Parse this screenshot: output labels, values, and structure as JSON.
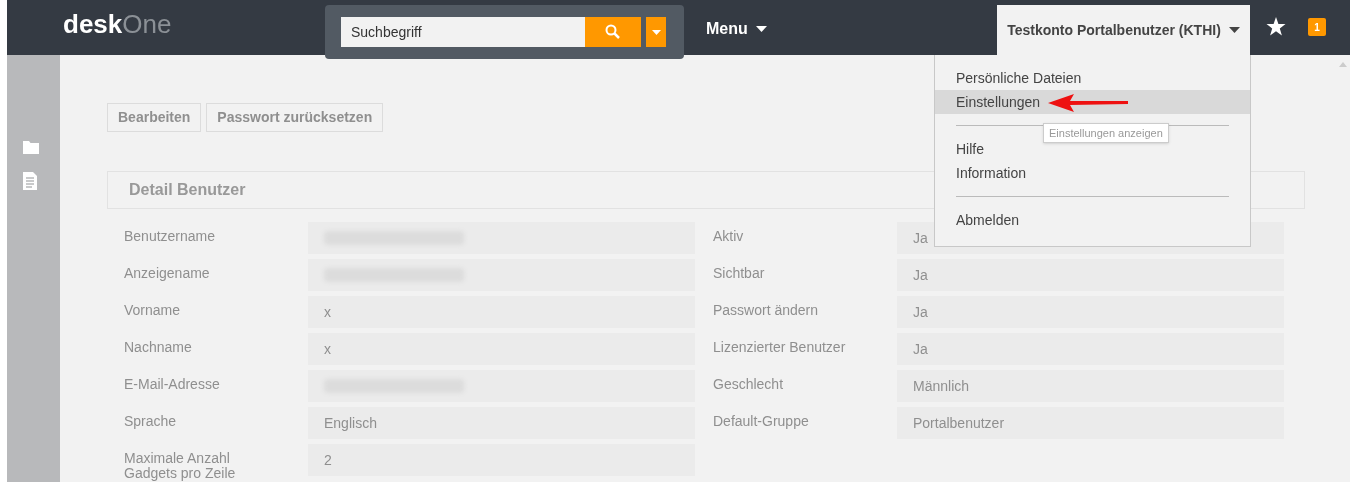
{
  "header": {
    "logo": {
      "bold": "desk",
      "light": "One"
    },
    "search": {
      "placeholder": "Suchbegriff"
    },
    "menu": "Menu",
    "user": "Testkonto Portalbenutzer (KTHI)",
    "notifications": "1"
  },
  "sidebar": {
    "items": [
      {
        "kind": "folder"
      },
      {
        "kind": "document"
      }
    ]
  },
  "actions": [
    "Bearbeiten",
    "Passwort zurücksetzen"
  ],
  "panel": {
    "title": "Detail Benutzer"
  },
  "fields_left": [
    {
      "label": "Benutzername",
      "kind": "blurred"
    },
    {
      "label": "Anzeigename",
      "kind": "blurred"
    },
    {
      "label": "Vorname",
      "kind": "text",
      "value": "x"
    },
    {
      "label": "Nachname",
      "kind": "text",
      "value": "x"
    },
    {
      "label": "E-Mail-Adresse",
      "kind": "blurred"
    },
    {
      "label": "Sprache",
      "kind": "text",
      "value": "Englisch"
    },
    {
      "label": "Maximale Anzahl Gadgets pro Zeile",
      "kind": "text",
      "value": "2"
    }
  ],
  "fields_right": [
    {
      "label": "Aktiv",
      "kind": "text",
      "value": "Ja"
    },
    {
      "label": "Sichtbar",
      "kind": "text",
      "value": "Ja"
    },
    {
      "label": "Passwort ändern",
      "kind": "text",
      "value": "Ja"
    },
    {
      "label": "Lizenzierter Benutzer",
      "kind": "text",
      "value": "Ja"
    },
    {
      "label": "Geschlecht",
      "kind": "text",
      "value": "Männlich"
    },
    {
      "label": "Default-Gruppe",
      "kind": "text",
      "value": "Portalbenutzer"
    }
  ],
  "user_menu": {
    "items": [
      {
        "kind": "item",
        "label": "Persönliche Dateien",
        "selected": false
      },
      {
        "kind": "item",
        "label": "Einstellungen",
        "selected": true
      },
      {
        "kind": "divider"
      },
      {
        "kind": "item",
        "label": "Hilfe",
        "selected": false
      },
      {
        "kind": "item",
        "label": "Information",
        "selected": false
      },
      {
        "kind": "divider"
      },
      {
        "kind": "item",
        "label": "Abmelden",
        "selected": false
      }
    ],
    "tooltip": "Einstellungen anzeigen"
  }
}
